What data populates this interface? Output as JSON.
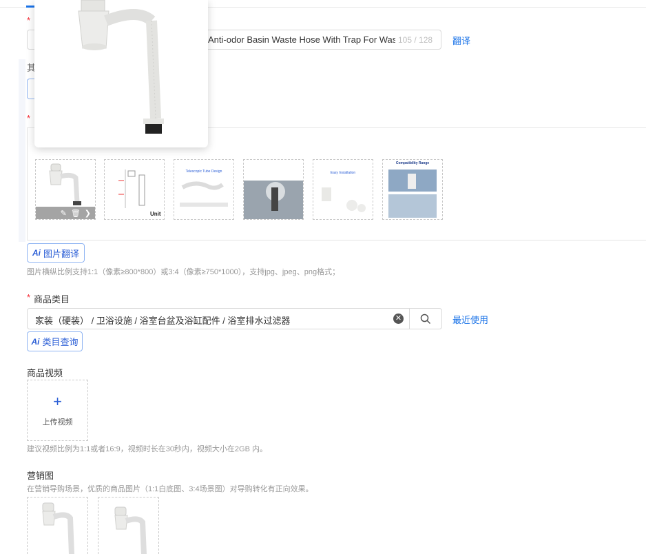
{
  "title_field": {
    "value": "Anti-odor Basin Waste Hose With Trap For Wash I",
    "counter": "105 / 128",
    "translate_link": "翻译"
  },
  "partial_label": "其",
  "image_section": {
    "ai_button_label": "图片翻译",
    "ai_mark": "Ai",
    "hint": "图片横纵比例支持1:1（像素≥800*800）或3:4（像素≥750*1000），支持jpg、jpeg、png格式；",
    "thumbnails": [
      {
        "caption": "",
        "unit_label": ""
      },
      {
        "caption": "",
        "unit_label": "Unit"
      },
      {
        "caption": "Telescopic Tube Design",
        "unit_label": ""
      },
      {
        "caption": "",
        "unit_label": ""
      },
      {
        "caption": "Easy Installation",
        "unit_label": ""
      },
      {
        "caption": "Compatibility Range",
        "unit_label": ""
      }
    ]
  },
  "category": {
    "label": "商品类目",
    "value": "家装（硬装） / 卫浴设施 / 浴室台盆及浴缸配件 / 浴室排水过滤器",
    "recent_link": "最近使用",
    "ai_button_label": "类目查询",
    "ai_mark": "Ai"
  },
  "video": {
    "label": "商品视频",
    "upload_label": "上传视频",
    "hint": "建议视频比例为1:1或者16:9，视频时长在30秒内，视频大小在2GB 内。"
  },
  "marketing": {
    "label": "营销图",
    "hint": "在营销导购场景，优质的商品图片（1:1白底图、3:4场景图）对导购转化有正向效果。"
  },
  "colors": {
    "accent": "#1a73e8",
    "required": "#f5222d",
    "product": "#e9e9e6"
  }
}
